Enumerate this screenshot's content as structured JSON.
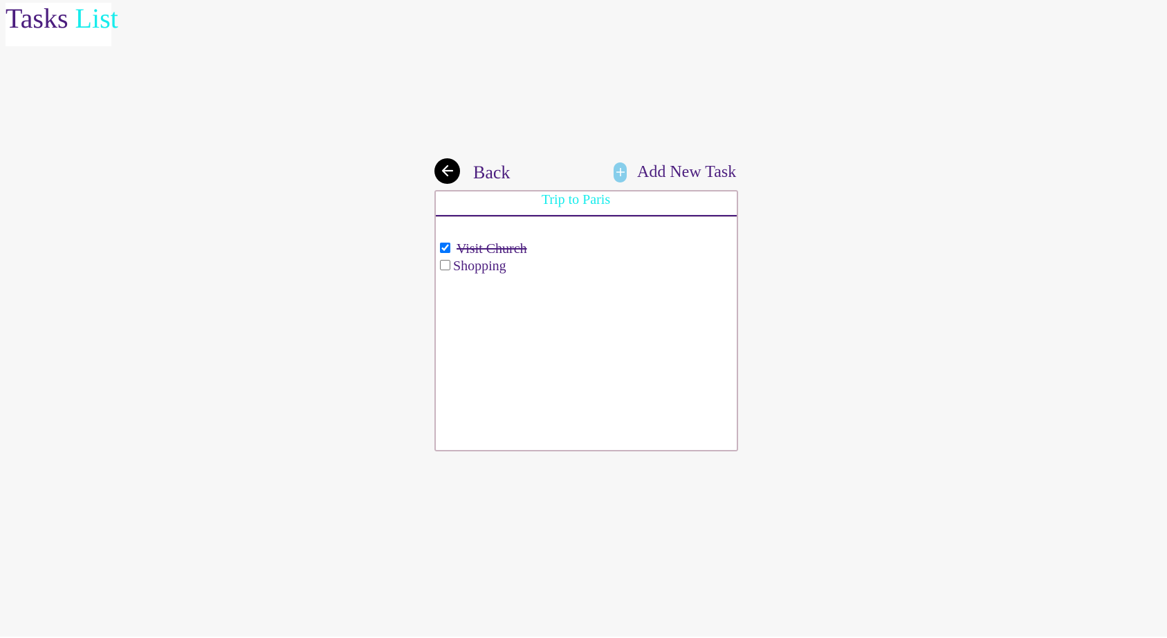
{
  "app": {
    "logo_word1": "Tasks",
    "logo_word2": "List",
    "colors": {
      "primary": "#4b1d7e",
      "accent": "#17ecec",
      "add_button": "#87ceeb",
      "background": "#f7f7f7"
    }
  },
  "toolbar": {
    "back_label": "Back",
    "back_icon": "arrow-left-icon",
    "add_label": "Add New Task",
    "add_icon": "plus-icon"
  },
  "list": {
    "title": "Trip to Paris",
    "tasks": [
      {
        "label": "Visit Church",
        "done": true
      },
      {
        "label": "Shopping",
        "done": false
      }
    ]
  }
}
